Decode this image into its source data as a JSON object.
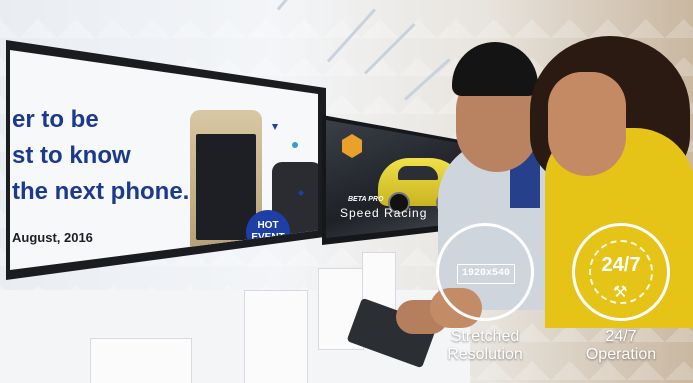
{
  "promo_screen": {
    "lines": [
      "er to be",
      "st to know",
      "the next phone."
    ],
    "date": "August, 2016",
    "badge_lines": [
      "HOT",
      "EVENT"
    ]
  },
  "game_screen": {
    "subtitle": "BETA PRO",
    "title": "Speed Racing"
  },
  "features": [
    {
      "icon": "resolution-frame-icon",
      "icon_text": "1920x540",
      "label_lines": [
        "Stretched",
        "Resolution"
      ]
    },
    {
      "icon": "operation-wrench-icon",
      "icon_text": "24/7",
      "label_lines": [
        "24/7",
        "Operation"
      ]
    }
  ],
  "colors": {
    "promo_text": "#1b3a8f",
    "badge": "#1e3ea8",
    "car": "#e6d43a",
    "jacket": "#e6c417",
    "feature_white": "#ffffff"
  }
}
